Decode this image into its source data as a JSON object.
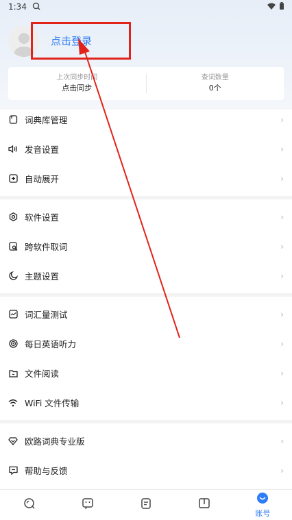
{
  "status_bar": {
    "time": "1:34"
  },
  "profile": {
    "login_label": "点击登录"
  },
  "stats": [
    {
      "label": "上次同步时间",
      "value": "点击同步"
    },
    {
      "label": "查词数量",
      "value": "0个"
    }
  ],
  "menu_groups": [
    [
      {
        "label": "词典库管理",
        "icon": "book-icon"
      },
      {
        "label": "发音设置",
        "icon": "speaker-icon"
      },
      {
        "label": "自动展开",
        "icon": "expand-icon"
      }
    ],
    [
      {
        "label": "软件设置",
        "icon": "settings-icon"
      },
      {
        "label": "跨软件取词",
        "icon": "lookup-icon"
      },
      {
        "label": "主题设置",
        "icon": "moon-icon"
      }
    ],
    [
      {
        "label": "词汇量测试",
        "icon": "chart-icon"
      },
      {
        "label": "每日英语听力",
        "icon": "listening-icon"
      },
      {
        "label": "文件阅读",
        "icon": "folder-icon"
      },
      {
        "label": "WiFi 文件传输",
        "icon": "wifi-icon"
      }
    ],
    [
      {
        "label": "欧路词典专业版",
        "icon": "diamond-icon"
      },
      {
        "label": "帮助与反馈",
        "icon": "feedback-icon"
      }
    ]
  ],
  "tabbar": {
    "account_label": "账号"
  },
  "colors": {
    "accent": "#2e7cf6",
    "annotation_red": "#e2231a"
  }
}
